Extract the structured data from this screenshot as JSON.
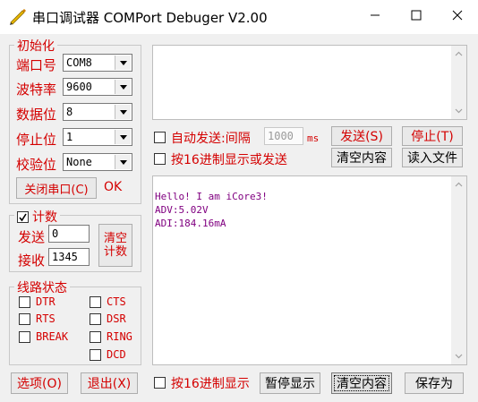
{
  "window": {
    "title": "串口调试器 COMPort Debuger V2.00",
    "icon": "pencil-icon"
  },
  "init_group": {
    "title": "初始化",
    "fields": [
      {
        "label": "端口号",
        "value": "COM8"
      },
      {
        "label": "波特率",
        "value": "9600"
      },
      {
        "label": "数据位",
        "value": "8"
      },
      {
        "label": "停止位",
        "value": "1"
      },
      {
        "label": "校验位",
        "value": "None"
      }
    ],
    "close_port_button": "关闭串口(C)",
    "status": "OK"
  },
  "count_group": {
    "title": "计数",
    "checked": true,
    "send_label": "发送",
    "send_value": "0",
    "recv_label": "接收",
    "recv_value": "1345",
    "clear_count_button": "清空\n计数"
  },
  "line_group": {
    "title": "线路状态",
    "signals": [
      "DTR",
      "RTS",
      "BREAK",
      "CTS",
      "DSR",
      "RING",
      "DCD"
    ]
  },
  "send_controls": {
    "auto_send_label": "自动发送:间隔",
    "interval_placeholder": "1000",
    "interval_unit": "ms",
    "send_button": "发送(S)",
    "stop_button": "停止(T)",
    "hex_send_label": "按16进制显示或发送",
    "clear_content_button": "清空内容",
    "read_file_button": "读入文件"
  },
  "receive": {
    "lines": [
      "Hello! I am iCore3!",
      "ADV:5.02V",
      "ADI:184.16mA"
    ]
  },
  "bottom": {
    "options_button": "选项(O)",
    "exit_button": "退出(X)",
    "hex_display_label": "按16进制显示",
    "pause_button": "暂停显示",
    "clear_button": "清空内容",
    "save_button": "保存为"
  },
  "colors": {
    "label_red": "#d40000",
    "receive_text": "#800080"
  }
}
